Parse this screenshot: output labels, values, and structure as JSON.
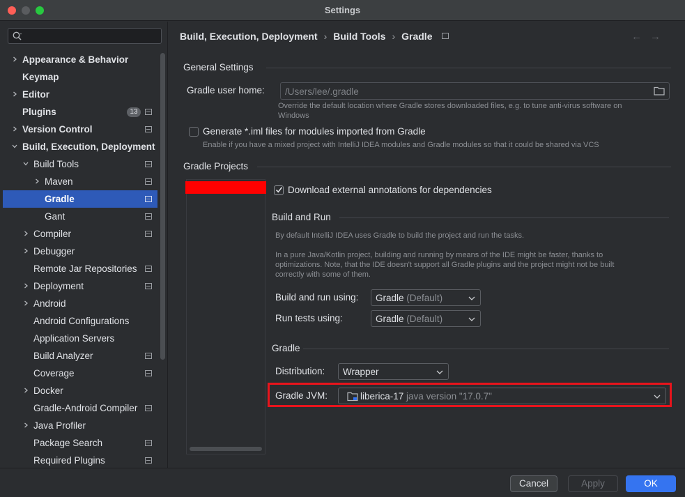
{
  "window": {
    "title": "Settings"
  },
  "search": {
    "placeholder": "",
    "value": ""
  },
  "sidebar": {
    "items": [
      {
        "label": "Appearance & Behavior",
        "indent": 0,
        "chevron": "right",
        "bold": true
      },
      {
        "label": "Keymap",
        "indent": 0,
        "chevron": "",
        "bold": true
      },
      {
        "label": "Editor",
        "indent": 0,
        "chevron": "right",
        "bold": true
      },
      {
        "label": "Plugins",
        "indent": 0,
        "chevron": "",
        "bold": true,
        "badge": "13",
        "proj": true
      },
      {
        "label": "Version Control",
        "indent": 0,
        "chevron": "right",
        "bold": true,
        "proj": true
      },
      {
        "label": "Build, Execution, Deployment",
        "indent": 0,
        "chevron": "down",
        "bold": true
      },
      {
        "label": "Build Tools",
        "indent": 1,
        "chevron": "down",
        "proj": true
      },
      {
        "label": "Maven",
        "indent": 2,
        "chevron": "right",
        "proj": true
      },
      {
        "label": "Gradle",
        "indent": 2,
        "chevron": "",
        "selected": true,
        "proj": true
      },
      {
        "label": "Gant",
        "indent": 2,
        "chevron": "",
        "proj": true
      },
      {
        "label": "Compiler",
        "indent": 1,
        "chevron": "right",
        "proj": true
      },
      {
        "label": "Debugger",
        "indent": 1,
        "chevron": "right"
      },
      {
        "label": "Remote Jar Repositories",
        "indent": 1,
        "chevron": "",
        "proj": true
      },
      {
        "label": "Deployment",
        "indent": 1,
        "chevron": "right",
        "proj": true
      },
      {
        "label": "Android",
        "indent": 1,
        "chevron": "right"
      },
      {
        "label": "Android Configurations",
        "indent": 1,
        "chevron": ""
      },
      {
        "label": "Application Servers",
        "indent": 1,
        "chevron": ""
      },
      {
        "label": "Build Analyzer",
        "indent": 1,
        "chevron": "",
        "proj": true
      },
      {
        "label": "Coverage",
        "indent": 1,
        "chevron": "",
        "proj": true
      },
      {
        "label": "Docker",
        "indent": 1,
        "chevron": "right"
      },
      {
        "label": "Gradle-Android Compiler",
        "indent": 1,
        "chevron": "",
        "proj": true
      },
      {
        "label": "Java Profiler",
        "indent": 1,
        "chevron": "right"
      },
      {
        "label": "Package Search",
        "indent": 1,
        "chevron": "",
        "proj": true
      },
      {
        "label": "Required Plugins",
        "indent": 1,
        "chevron": "",
        "proj": true
      }
    ]
  },
  "help": {
    "label": "?"
  },
  "breadcrumb": {
    "items": [
      "Build, Execution, Deployment",
      "Build Tools",
      "Gradle"
    ],
    "separator": "›",
    "back": "←",
    "forward": "→"
  },
  "general": {
    "title": "General Settings",
    "user_home_label": "Gradle user home:",
    "user_home_value": "/Users/lee/.gradle",
    "user_home_hint_1": "Override the default location where Gradle stores downloaded files, e.g. to tune anti-virus software on",
    "user_home_hint_2": "Windows",
    "iml_label": "Generate *.iml files for modules imported from Gradle",
    "iml_checked": false,
    "iml_hint": "Enable if you have a mixed project with IntelliJ IDEA modules and Gradle modules so that it could be shared via VCS"
  },
  "projects": {
    "title": "Gradle Projects",
    "download_annotations_label": "Download external annotations for dependencies",
    "download_annotations_checked": true,
    "build_run": {
      "title": "Build and Run",
      "hint_1": "By default IntelliJ IDEA uses Gradle to build the project and run the tasks.",
      "hint_2": "In a pure Java/Kotlin project, building and running by means of the IDE might be faster, thanks to",
      "hint_3": "optimizations. Note, that the IDE doesn't support all Gradle plugins and the project might not be built",
      "hint_4": "correctly with some of them.",
      "build_using_label": "Build and run using:",
      "build_using_value": "Gradle",
      "build_using_suffix": "(Default)",
      "tests_using_label": "Run tests using:",
      "tests_using_value": "Gradle",
      "tests_using_suffix": "(Default)"
    },
    "gradle": {
      "title": "Gradle",
      "distribution_label": "Distribution:",
      "distribution_value": "Wrapper",
      "jvm_label": "Gradle JVM:",
      "jvm_value": "liberica-17",
      "jvm_suffix": "java version \"17.0.7\""
    }
  },
  "footer": {
    "cancel": "Cancel",
    "apply": "Apply",
    "ok": "OK"
  },
  "colors": {
    "accent": "#3574f0",
    "selection": "#2e5ab8",
    "highlight": "#e8141c",
    "redaction": "#ff0000"
  }
}
